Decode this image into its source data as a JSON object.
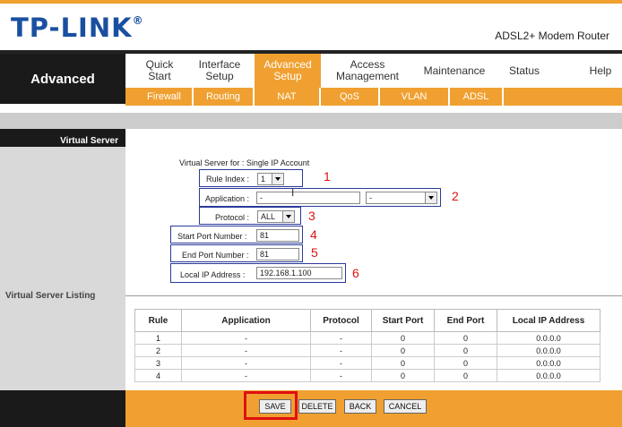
{
  "brand": {
    "logo": "TP-LINK",
    "reg": "®",
    "model": "ADSL2+ Modem Router"
  },
  "side": {
    "section": "Advanced",
    "virtual_server": "Virtual Server",
    "listing": "Virtual Server Listing"
  },
  "menu": {
    "quick": [
      "Quick",
      "Start"
    ],
    "interface": [
      "Interface",
      "Setup"
    ],
    "advanced": [
      "Advanced",
      "Setup"
    ],
    "access": [
      "Access",
      "Management"
    ],
    "maintenance": "Maintenance",
    "status": "Status",
    "help": "Help"
  },
  "submenu": {
    "firewall": "Firewall",
    "routing": "Routing",
    "nat": "NAT",
    "qos": "QoS",
    "vlan": "VLAN",
    "adsl": "ADSL"
  },
  "form": {
    "header": "Virtual Server for : Single IP Account",
    "rule_index_label": "Rule Index :",
    "rule_index_value": "1",
    "application_label": "Application :",
    "application_value": "-",
    "application_select": "-",
    "protocol_label": "Protocol :",
    "protocol_value": "ALL",
    "start_port_label": "Start Port Number :",
    "start_port_value": "81",
    "end_port_label": "End Port Number :",
    "end_port_value": "81",
    "local_ip_label": "Local IP Address :",
    "local_ip_value": "192.168.1.100"
  },
  "annotations": {
    "n1": "1",
    "n2": "2",
    "n3": "3",
    "n4": "4",
    "n5": "5",
    "n6": "6"
  },
  "table": {
    "headers": [
      "Rule",
      "Application",
      "Protocol",
      "Start Port",
      "End Port",
      "Local IP Address"
    ],
    "rows": [
      [
        "1",
        "-",
        "-",
        "0",
        "0",
        "0.0.0.0"
      ],
      [
        "2",
        "-",
        "-",
        "0",
        "0",
        "0.0.0.0"
      ],
      [
        "3",
        "-",
        "-",
        "0",
        "0",
        "0.0.0.0"
      ],
      [
        "4",
        "-",
        "-",
        "0",
        "0",
        "0.0.0.0"
      ]
    ]
  },
  "buttons": {
    "save": "SAVE",
    "delete": "DELETE",
    "back": "BACK",
    "cancel": "CANCEL"
  },
  "colors": {
    "accent": "#f0a030",
    "dark": "#1a1a1a",
    "brand": "#1a4fa0",
    "highlight": "#e01010",
    "frame": "#2a3a9a"
  }
}
